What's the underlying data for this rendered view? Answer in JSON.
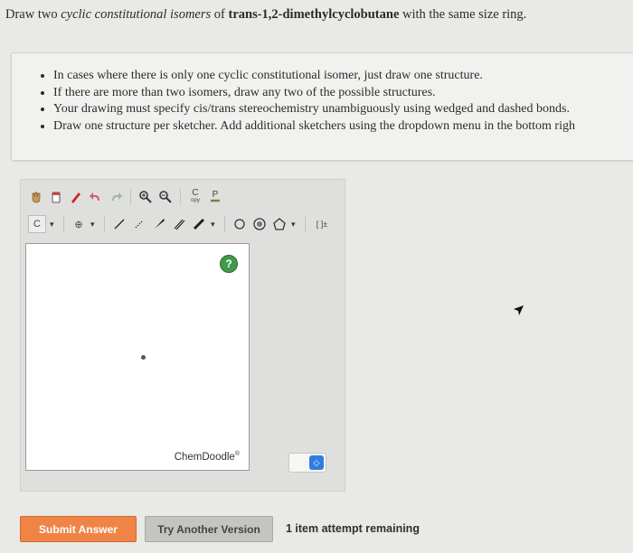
{
  "question": {
    "part1": "Draw two ",
    "part2": "cyclic constitutional isomers",
    "part3": " of ",
    "part4": "trans-1,2-dimethylcyclobutane",
    "part5": " with the same size ring."
  },
  "instructions": [
    "In cases where there is only one cyclic constitutional isomer, just draw one structure.",
    "If there are more than two isomers, draw any two of the possible structures.",
    "Your drawing must specify cis/trans stereochemistry unambiguously using wedged and dashed bonds.",
    "Draw one structure per sketcher. Add additional sketchers using the dropdown menu in the bottom righ"
  ],
  "toolbar": {
    "clean_label": "C",
    "clean_sub": "opy",
    "paste_label": "P",
    "carbon_label": "C",
    "charge_label": "⊕",
    "ring_bracket": "[ ]±"
  },
  "sketcher": {
    "help_label": "?",
    "brand": "ChemDoodle",
    "brand_mark": "®"
  },
  "buttons": {
    "submit": "Submit Answer",
    "try_another": "Try Another Version"
  },
  "attempts": "1 item attempt remaining",
  "colors": {
    "submit_bg": "#f08447",
    "help_bg": "#3f9a4a",
    "select_arrow": "#2f7de0"
  }
}
